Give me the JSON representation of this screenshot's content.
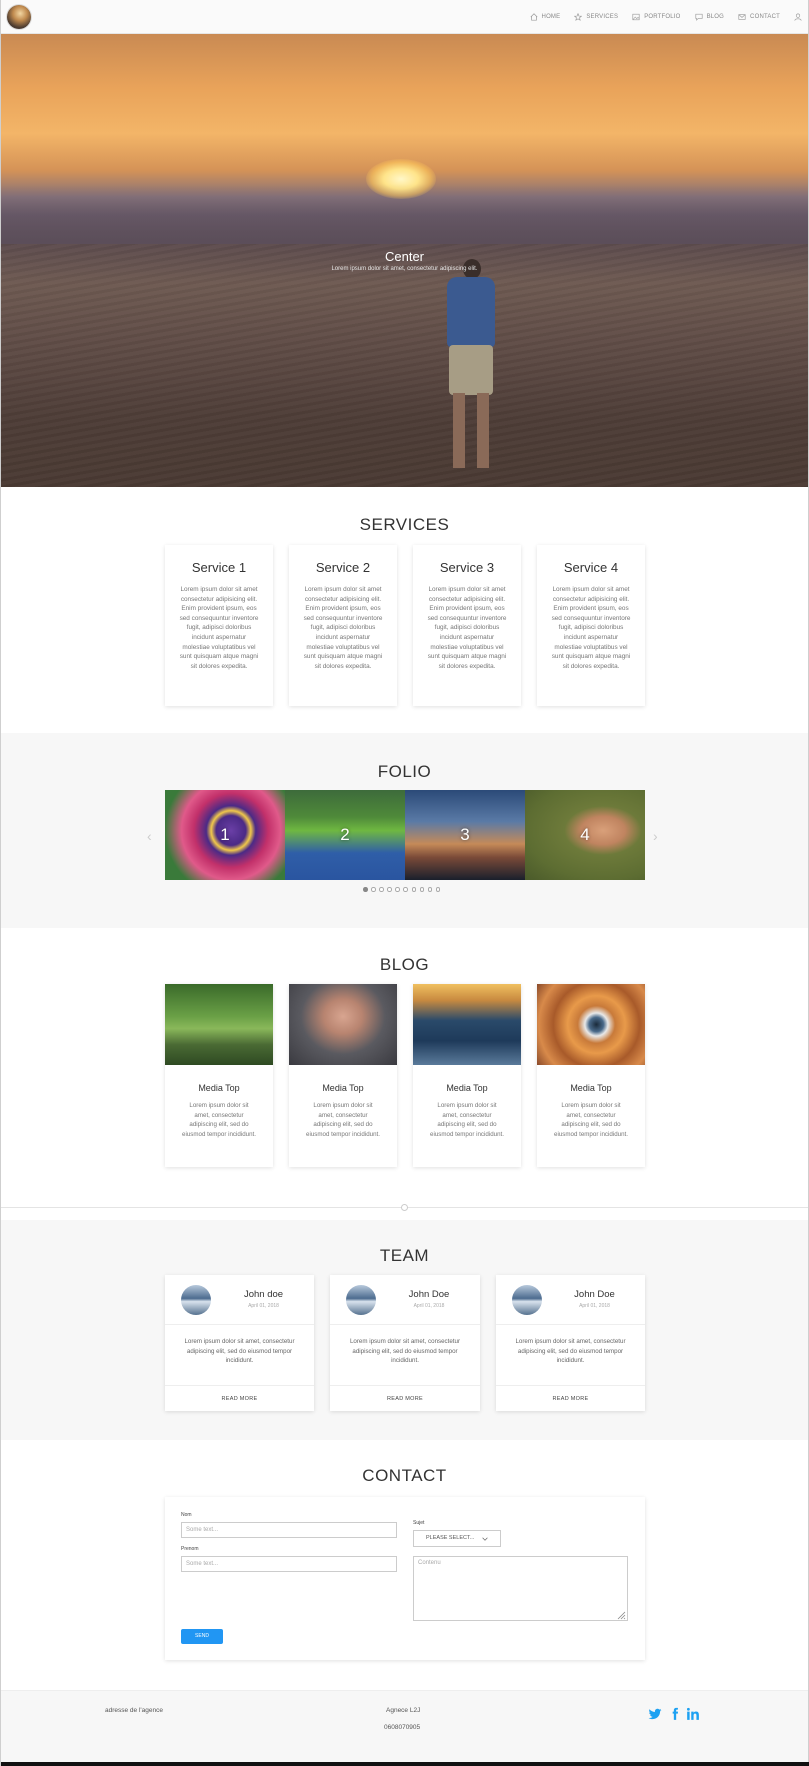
{
  "nav": {
    "items": [
      {
        "label": "HOME",
        "icon": "home-icon"
      },
      {
        "label": "SERVICES",
        "icon": "star-icon"
      },
      {
        "label": "PORTFOLIO",
        "icon": "image-icon"
      },
      {
        "label": "BLOG",
        "icon": "chat-icon"
      },
      {
        "label": "CONTACT",
        "icon": "mail-icon"
      }
    ],
    "user_icon": "user-icon"
  },
  "hero": {
    "title": "Center",
    "subtitle": "Lorem ipsum dolor sit amet, consectetur adipiscing elit."
  },
  "services": {
    "title": "SERVICES",
    "items": [
      {
        "title": "Service 1",
        "text": "Lorem ipsum dolor sit amet consectetur adipisicing elit. Enim provident ipsum, eos sed consequuntur inventore fugit, adipisci doloribus incidunt aspernatur molestiae voluptatibus vel sunt quisquam atque magni sit dolores expedita."
      },
      {
        "title": "Service 2",
        "text": "Lorem ipsum dolor sit amet consectetur adipisicing elit. Enim provident ipsum, eos sed consequuntur inventore fugit, adipisci doloribus incidunt aspernatur molestiae voluptatibus vel sunt quisquam atque magni sit dolores expedita."
      },
      {
        "title": "Service 3",
        "text": "Lorem ipsum dolor sit amet consectetur adipisicing elit. Enim provident ipsum, eos sed consequuntur inventore fugit, adipisci doloribus incidunt aspernatur molestiae voluptatibus vel sunt quisquam atque magni sit dolores expedita."
      },
      {
        "title": "Service 4",
        "text": "Lorem ipsum dolor sit amet consectetur adipisicing elit. Enim provident ipsum, eos sed consequuntur inventore fugit, adipisci doloribus incidunt aspernatur molestiae voluptatibus vel sunt quisquam atque magni sit dolores expedita."
      }
    ]
  },
  "folio": {
    "title": "FOLIO",
    "slides": [
      "1",
      "2",
      "3",
      "4"
    ],
    "prev_icon": "chevron-left-icon",
    "next_icon": "chevron-right-icon",
    "dot_count": 10,
    "active_dot": 0
  },
  "blog": {
    "title": "BLOG",
    "posts": [
      {
        "title": "Media Top",
        "text": "Lorem ipsum dolor sit amet, consectetur adipiscing elit, sed do eiusmod tempor incididunt."
      },
      {
        "title": "Media Top",
        "text": "Lorem ipsum dolor sit amet, consectetur adipiscing elit, sed do eiusmod tempor incididunt."
      },
      {
        "title": "Media Top",
        "text": "Lorem ipsum dolor sit amet, consectetur adipiscing elit, sed do eiusmod tempor incididunt."
      },
      {
        "title": "Media Top",
        "text": "Lorem ipsum dolor sit amet, consectetur adipiscing elit, sed do eiusmod tempor incididunt."
      }
    ]
  },
  "team": {
    "title": "TEAM",
    "members": [
      {
        "name": "John doe",
        "date": "April 01, 2018",
        "text": "Lorem ipsum dolor sit amet, consectetur adipiscing elit, sed do eiusmod tempor incididunt.",
        "action": "READ MORE"
      },
      {
        "name": "John Doe",
        "date": "April 01, 2018",
        "text": "Lorem ipsum dolor sit amet, consectetur adipiscing elit, sed do eiusmod tempor incididunt.",
        "action": "READ MORE"
      },
      {
        "name": "John Doe",
        "date": "April 01, 2018",
        "text": "Lorem ipsum dolor sit amet, consectetur adipiscing elit, sed do eiusmod tempor incididunt.",
        "action": "READ MORE"
      }
    ]
  },
  "contact": {
    "title": "CONTACT",
    "nom_label": "Nom",
    "nom_placeholder": "Some text...",
    "prenom_label": "Prenom",
    "prenom_placeholder": "Some text...",
    "sujet_label": "Sujet",
    "sujet_value": "PLEASE SELECT...",
    "contenu_placeholder": "Contenu",
    "send_label": "SEND"
  },
  "footer": {
    "address": "adresse de l'agence",
    "agency": "Agnece L2J",
    "phone": "0608070905",
    "social": [
      "twitter-icon",
      "facebook-icon",
      "linkedin-icon"
    ]
  },
  "colors": {
    "accent": "#2196f3",
    "twitter": "#1da1f2"
  }
}
